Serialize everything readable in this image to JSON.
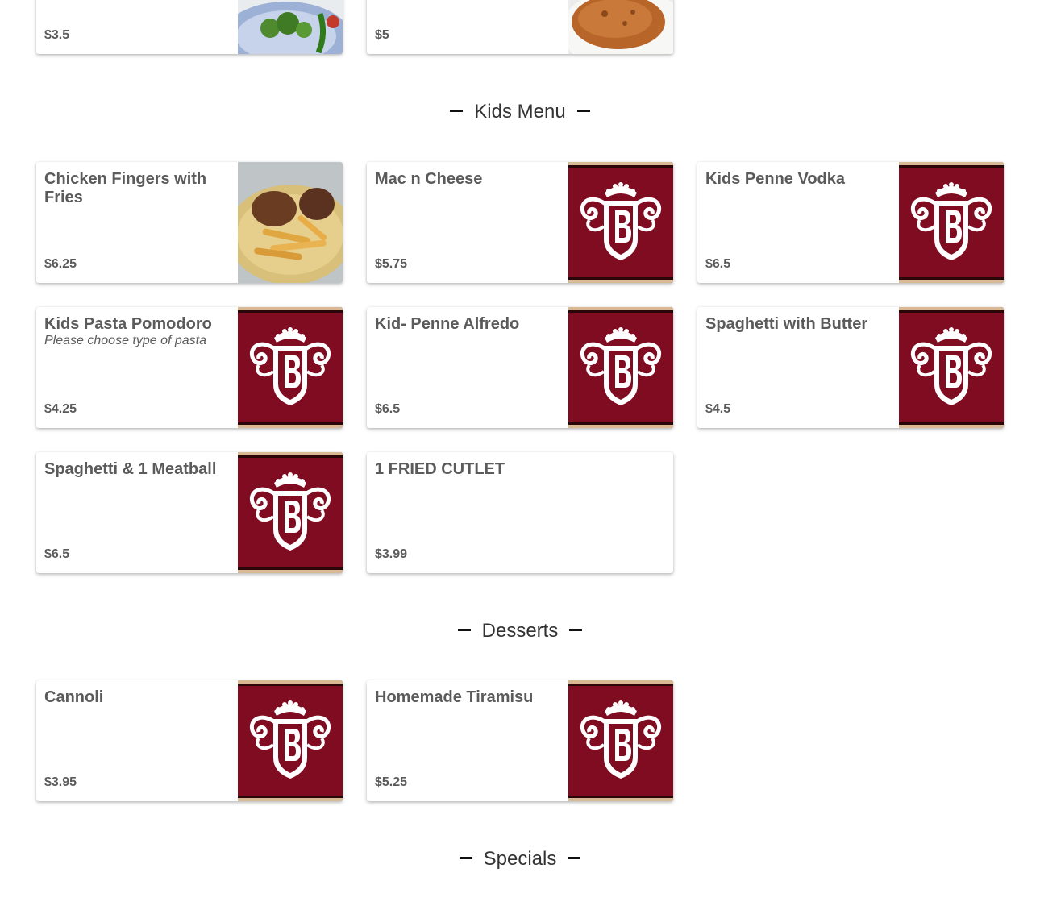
{
  "colors": {
    "brand": "#7f0c20",
    "trim": "#d8b994",
    "text": "#5b5b5b",
    "heading": "#333333"
  },
  "top_partial": [
    {
      "price": "$3.5",
      "image": "broccoli-plate-photo"
    },
    {
      "price": "$5",
      "image": "fried-cutlet-photo"
    }
  ],
  "sections": {
    "kids": {
      "title": "Kids Menu",
      "items": [
        {
          "name": "Chicken Fingers with Fries",
          "price": "$6.25",
          "image": "chicken-fingers-fries-photo"
        },
        {
          "name": "Mac n Cheese",
          "price": "$5.75",
          "image": "restaurant-logo"
        },
        {
          "name": "Kids Penne Vodka",
          "price": "$6.5",
          "image": "restaurant-logo"
        },
        {
          "name": "Kids Pasta Pomodoro",
          "description": "Please choose type of pasta",
          "price": "$4.25",
          "image": "restaurant-logo"
        },
        {
          "name": "Kid- Penne Alfredo",
          "price": "$6.5",
          "image": "restaurant-logo"
        },
        {
          "name": "Spaghetti with Butter",
          "price": "$4.5",
          "image": "restaurant-logo"
        },
        {
          "name": "Spaghetti & 1 Meatball",
          "price": "$6.5",
          "image": "restaurant-logo"
        },
        {
          "name": "1 FRIED CUTLET",
          "price": "$3.99"
        }
      ]
    },
    "desserts": {
      "title": "Desserts",
      "items": [
        {
          "name": "Cannoli",
          "price": "$3.95",
          "image": "restaurant-logo"
        },
        {
          "name": "Homemade Tiramisu",
          "price": "$5.25",
          "image": "restaurant-logo"
        }
      ]
    },
    "specials": {
      "title": "Specials"
    }
  }
}
